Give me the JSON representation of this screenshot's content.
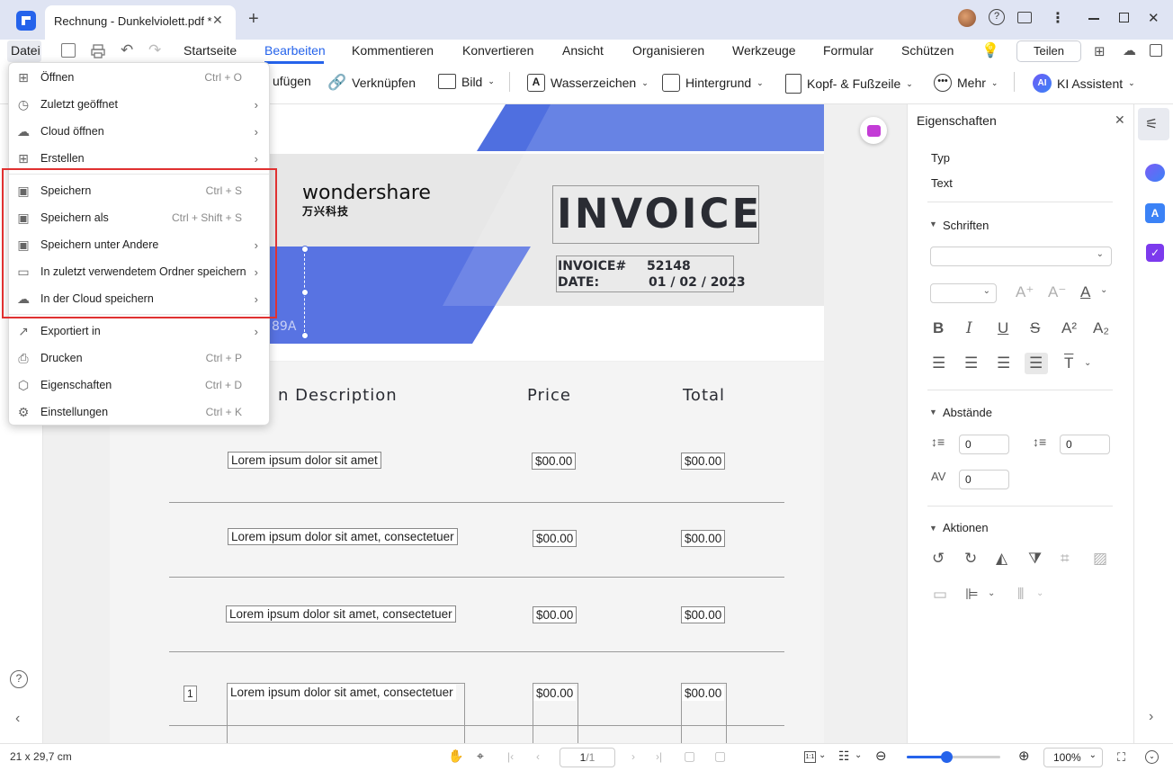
{
  "titlebar": {
    "doc_tab": "Rechnung - Dunkelviolett.pdf *"
  },
  "menubar": {
    "file": "Datei",
    "tabs": [
      "Startseite",
      "Bearbeiten",
      "Kommentieren",
      "Konvertieren",
      "Ansicht",
      "Organisieren",
      "Werkzeuge",
      "Formular",
      "Schützen"
    ],
    "share": "Teilen"
  },
  "toolbar": {
    "partial_add": "ufügen",
    "link": "Verknüpfen",
    "image": "Bild",
    "watermark": "Wasserzeichen",
    "background": "Hintergrund",
    "header_footer": "Kopf- & Fußzeile",
    "more": "Mehr",
    "ai_badge": "AI",
    "ai": "KI Assistent"
  },
  "file_menu": {
    "items": [
      {
        "label": "Öffnen",
        "shortcut": "Ctrl + O",
        "submenu": false
      },
      {
        "label": "Zuletzt geöffnet",
        "shortcut": "",
        "submenu": true
      },
      {
        "label": "Cloud öffnen",
        "shortcut": "",
        "submenu": true
      },
      {
        "label": "Erstellen",
        "shortcut": "",
        "submenu": true
      },
      {
        "label": "Speichern",
        "shortcut": "Ctrl + S",
        "submenu": false
      },
      {
        "label": "Speichern als",
        "shortcut": "Ctrl + Shift + S",
        "submenu": false
      },
      {
        "label": "Speichern unter Andere",
        "shortcut": "",
        "submenu": true
      },
      {
        "label": "In zuletzt verwendetem Ordner speichern",
        "shortcut": "",
        "submenu": true
      },
      {
        "label": "In der Cloud speichern",
        "shortcut": "",
        "submenu": true
      },
      {
        "label": "Exportiert in",
        "shortcut": "",
        "submenu": true
      },
      {
        "label": "Drucken",
        "shortcut": "Ctrl + P",
        "submenu": false
      },
      {
        "label": "Eigenschaften",
        "shortcut": "Ctrl + D",
        "submenu": false
      },
      {
        "label": "Einstellungen",
        "shortcut": "Ctrl + K",
        "submenu": false
      }
    ]
  },
  "invoice": {
    "brand": "wondershare",
    "brand_cn": "万兴科技",
    "title": "INVOICE",
    "number_label": "INVOICE#",
    "number": "52148",
    "date_label": "DATE:",
    "date": "01 / 02 / 2023",
    "partial_code": "89A",
    "col_desc": "n Description",
    "col_price": "Price",
    "col_total": "Total",
    "rows": [
      {
        "desc": "Lorem ipsum dolor sit amet",
        "price": "$00.00",
        "total": "$00.00"
      },
      {
        "desc": "Lorem ipsum dolor sit amet, consectetuer",
        "price": "$00.00",
        "total": "$00.00"
      },
      {
        "desc": "Lorem ipsum dolor sit amet, consectetuer",
        "price": "$00.00",
        "total": "$00.00"
      },
      {
        "desc": "Lorem ipsum dolor sit amet, consectetuer",
        "price": "$00.00",
        "total": "$00.00"
      }
    ],
    "row4_num": "1"
  },
  "properties": {
    "title": "Eigenschaften",
    "type_label": "Typ",
    "type_value": "Text",
    "fonts": "Schriften",
    "spacing": "Abstände",
    "line_spacing": "0",
    "para_spacing": "0",
    "char_spacing": "0",
    "actions": "Aktionen"
  },
  "status": {
    "page_size": "21 x 29,7 cm",
    "page_num": "1",
    "page_total": "/1",
    "zoom": "100%",
    "zoom_fraction": 0.42
  },
  "colors": {
    "accent": "#2563eb",
    "invoice_blue": "#4f6fe0",
    "highlight": "#e03131"
  }
}
